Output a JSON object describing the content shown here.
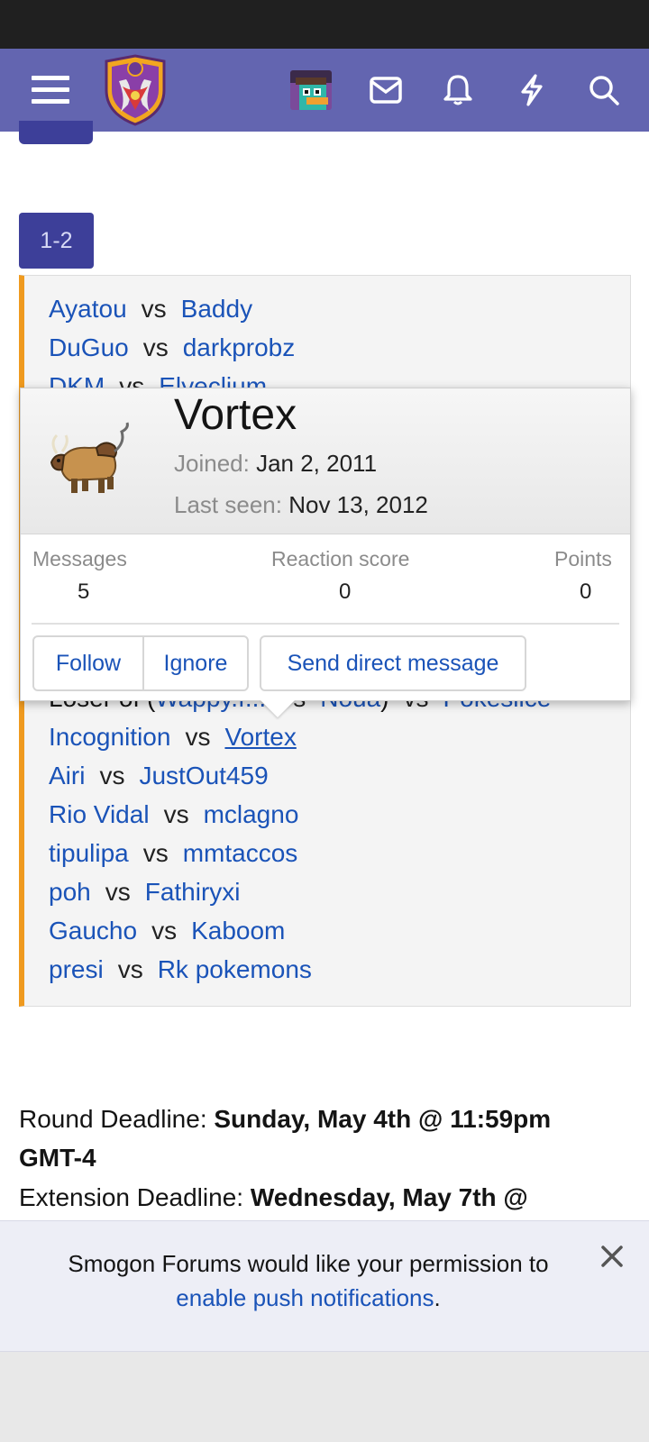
{
  "header": {
    "menu_icon": "hamburger-icon",
    "logo_icon": "smogon-crest-logo",
    "avatar_icon": "user-avatar",
    "inbox_icon": "envelope-icon",
    "alerts_icon": "bell-icon",
    "whats_new_icon": "bolt-icon",
    "search_icon": "search-icon",
    "accent_color": "#6365b0"
  },
  "bracket": {
    "round_label": "1-2",
    "vs_label": "vs",
    "matches_top": [
      {
        "p1": "Ayatou",
        "p2": "Baddy"
      },
      {
        "p1": "DuGuo",
        "p2": "darkprobz"
      },
      {
        "p1": "DKM",
        "p2": "Elyeclium"
      }
    ],
    "partial_row": {
      "prefix": "Loser of (",
      "p1": "Wappy.f...",
      "mid_vs": "vs",
      "p2": "Noua",
      "suffix": ")",
      "p3": "Pokeslice"
    },
    "matches_bottom": [
      {
        "p1": "Incognition",
        "p2": "Vortex"
      },
      {
        "p1": "Airi",
        "p2": "JustOut459"
      },
      {
        "p1": "Rio Vidal",
        "p2": "mclagno"
      },
      {
        "p1": "tipulipa",
        "p2": "mmtaccos"
      },
      {
        "p1": "poh",
        "p2": "Fathiryxi"
      },
      {
        "p1": "Gaucho",
        "p2": "Kaboom"
      },
      {
        "p1": "presi",
        "p2": "Rk pokemons"
      }
    ],
    "border_color": "#ef9a1f"
  },
  "member_card": {
    "avatar_icon": "tauros-sprite",
    "name": "Vortex",
    "joined_label": "Joined:",
    "joined_value": "Jan 2, 2011",
    "last_seen_label": "Last seen:",
    "last_seen_value": "Nov 13, 2012",
    "stats": [
      {
        "label": "Messages",
        "value": "5"
      },
      {
        "label": "Reaction score",
        "value": "0"
      },
      {
        "label": "Points",
        "value": "0"
      }
    ],
    "follow_label": "Follow",
    "ignore_label": "Ignore",
    "message_label": "Send direct message"
  },
  "deadlines": {
    "round_label": "Round Deadline:",
    "round_value": "Sunday, May 4th @ 11:59pm",
    "round_value_cont": "GMT-4",
    "extension_label": "Extension Deadline:",
    "extension_value": "Wednesday, May 7th @"
  },
  "push_notice": {
    "text": "Smogon Forums would like your permission to",
    "link": "enable push notifications",
    "suffix": ".",
    "close_icon": "close-icon"
  }
}
